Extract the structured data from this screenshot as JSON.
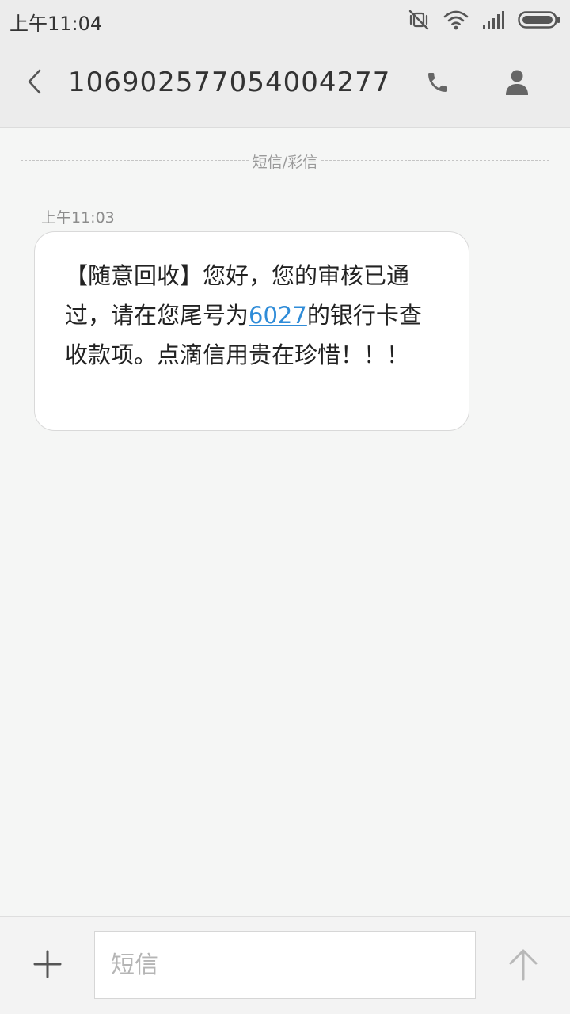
{
  "status_bar": {
    "time": "上午11:04",
    "icons": [
      "vibrate-off-icon",
      "wifi-icon",
      "signal-icon",
      "battery-icon"
    ]
  },
  "header": {
    "title": "106902577054004277",
    "back_icon": "chevron-left-icon",
    "call_icon": "phone-icon",
    "contact_icon": "person-icon"
  },
  "conversation": {
    "type_label": "短信/彩信",
    "messages": [
      {
        "time": "上午11:03",
        "text_before_link": "【随意回收】您好，您的审核已通过，请在您尾号为",
        "link_text": "6027",
        "text_after_link": "的银行卡查收款项。点滴信用贵在珍惜！！！"
      }
    ]
  },
  "composer": {
    "placeholder": "短信",
    "value": "",
    "add_icon": "plus-icon",
    "send_icon": "arrow-up-icon"
  },
  "colors": {
    "link": "#2f8cd8",
    "background": "#f5f6f5",
    "header_bg": "#ececec"
  }
}
